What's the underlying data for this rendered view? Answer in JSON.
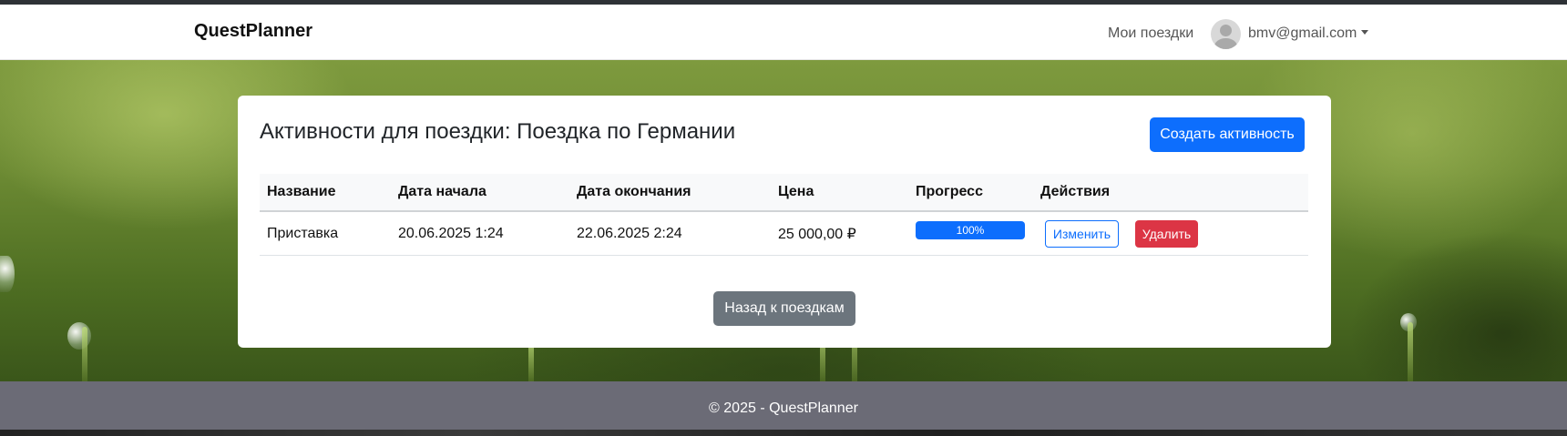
{
  "navbar": {
    "brand": "QuestPlanner",
    "my_trips_link": "Мои поездки",
    "user_email": "bmv@gmail.com",
    "avatar_icon": "user-avatar-icon",
    "caret_icon": "caret-down-icon"
  },
  "card": {
    "title": "Активности для поездки: Поездка по Германии",
    "create_button": "Создать активность",
    "back_button": "Назад к поездкам"
  },
  "table": {
    "headers": [
      "Название",
      "Дата начала",
      "Дата окончания",
      "Цена",
      "Прогресс",
      "Действия"
    ],
    "rows": [
      {
        "name": "Приставка",
        "start": "20.06.2025 1:24",
        "end": "22.06.2025 2:24",
        "price": "25 000,00 ₽",
        "progress_label": "100%",
        "progress_value": 1.0,
        "edit_label": "Изменить",
        "delete_label": "Удалить"
      }
    ]
  },
  "footer": {
    "text": "© 2025 - QuestPlanner"
  },
  "colors": {
    "primary": "#0d6efd",
    "danger": "#dc3545",
    "secondary": "#6c757d",
    "footer_bg": "#6b6b76"
  }
}
